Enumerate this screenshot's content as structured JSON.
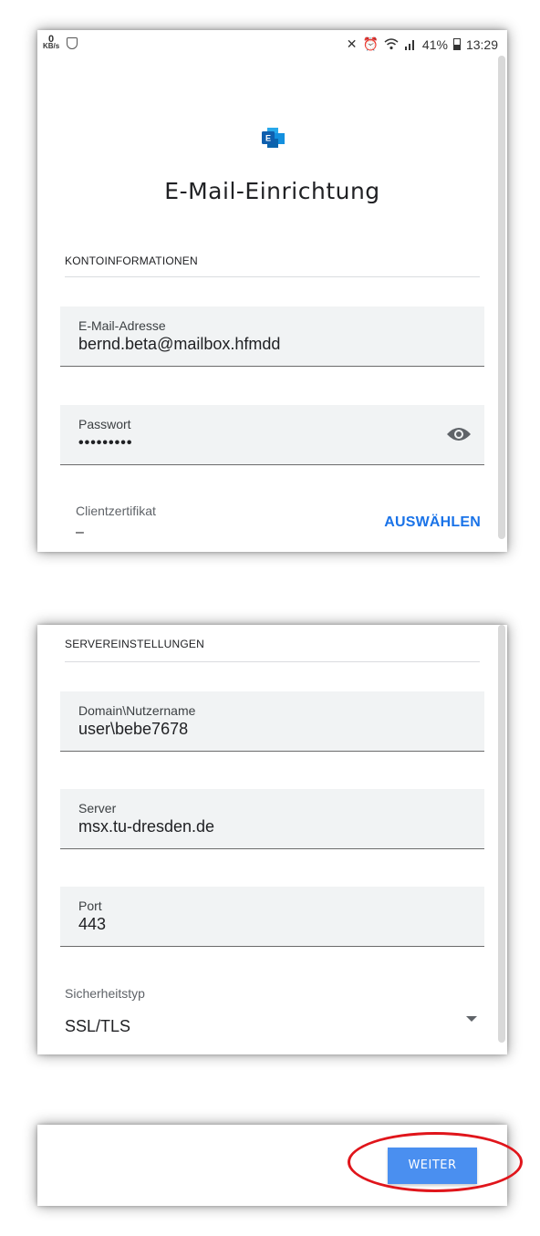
{
  "status_bar": {
    "net_speed_value": "0",
    "net_speed_unit": "KB/s",
    "battery_percent": "41%",
    "time": "13:29"
  },
  "header": {
    "title": "E-Mail-Einrichtung",
    "logo": "exchange-logo"
  },
  "account_section": {
    "label": "KONTOINFORMATIONEN",
    "email": {
      "label": "E-Mail-Adresse",
      "value": "bernd.beta@mailbox.hfmdd"
    },
    "password": {
      "label": "Passwort",
      "value": "•••••••••",
      "toggle_icon": "eye-icon"
    },
    "client_certificate": {
      "label": "Clientzertifikat",
      "value": "–",
      "action_label": "AUSWÄHLEN"
    }
  },
  "server_section": {
    "label": "SERVEREINSTELLUNGEN",
    "domain_username": {
      "label": "Domain\\Nutzername",
      "value": "user\\bebe7678"
    },
    "server": {
      "label": "Server",
      "value": "msx.tu-dresden.de"
    },
    "port": {
      "label": "Port",
      "value": "443"
    },
    "security_type": {
      "label": "Sicherheitstyp",
      "value": "SSL/TLS"
    }
  },
  "footer": {
    "next_button": "WEITER"
  },
  "colors": {
    "accent": "#1a73e8",
    "button": "#4a8ff0",
    "highlight": "#e0151b",
    "field_bg": "#f1f3f4"
  }
}
